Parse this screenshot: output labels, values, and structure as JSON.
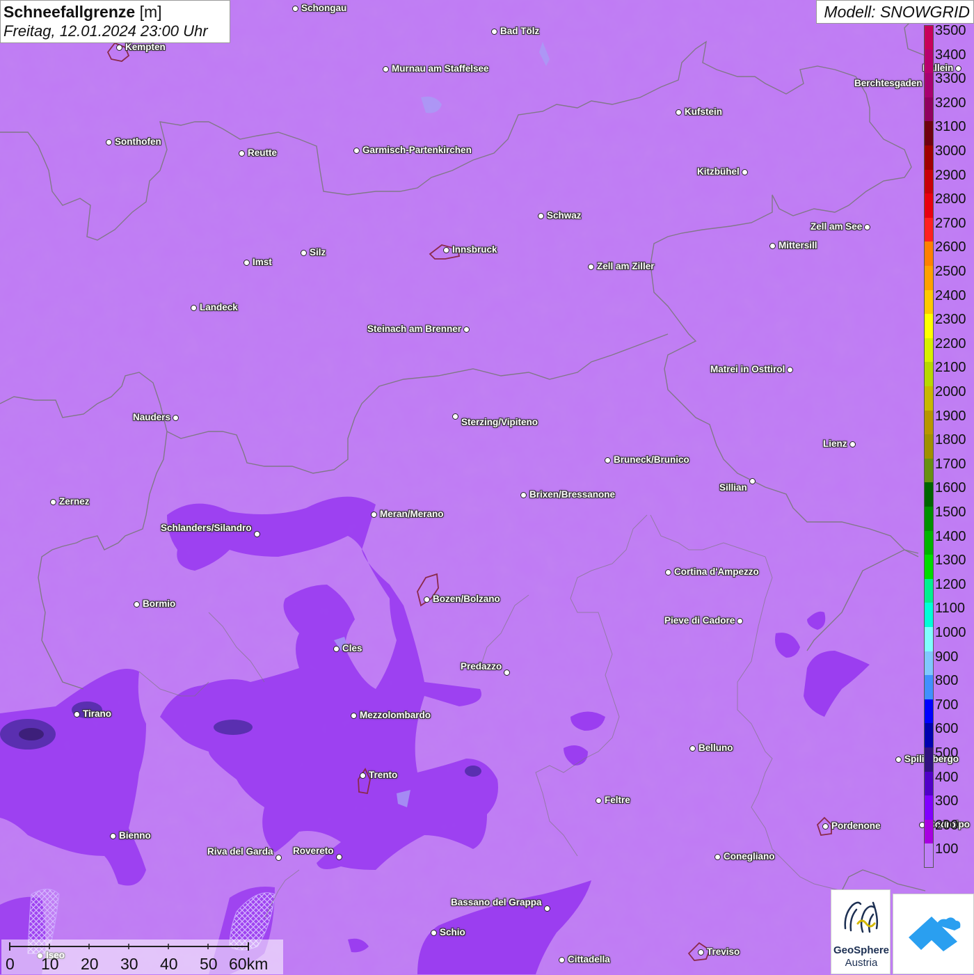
{
  "header": {
    "title": "Schneefallgrenze",
    "unit": "[m]",
    "datetime": "Freitag, 12.01.2024 23:00 Uhr",
    "model": "Modell: SNOWGRID"
  },
  "legend": {
    "labels": [
      "3500",
      "3400",
      "3300",
      "3200",
      "3100",
      "3000",
      "2900",
      "2800",
      "2700",
      "2600",
      "2500",
      "2400",
      "2300",
      "2200",
      "2100",
      "2000",
      "1900",
      "1800",
      "1700",
      "1600",
      "1500",
      "1400",
      "1300",
      "1200",
      "1100",
      "1000",
      "900",
      "800",
      "700",
      "600",
      "500",
      "400",
      "300",
      "200",
      "100"
    ],
    "colors": [
      "#c8005a",
      "#b8006e",
      "#a80070",
      "#900060",
      "#700010",
      "#a00000",
      "#c80008",
      "#e80010",
      "#ff2020",
      "#ff8000",
      "#ffa000",
      "#ffc800",
      "#ffff00",
      "#d8f000",
      "#b8d800",
      "#c8b800",
      "#b89600",
      "#a09000",
      "#689010",
      "#006400",
      "#009000",
      "#00b400",
      "#00dc00",
      "#00f090",
      "#00ffd8",
      "#80ffff",
      "#80c8ff",
      "#4090ff",
      "#0000ff",
      "#0000b0",
      "#301080",
      "#5000c8",
      "#8000ff",
      "#a800e0",
      "#c080f8"
    ]
  },
  "cities": [
    {
      "name": "Schongau"
    },
    {
      "name": "Bad Tölz"
    },
    {
      "name": "Kempten"
    },
    {
      "name": "Murnau am Staffelsee"
    },
    {
      "name": "Hallein"
    },
    {
      "name": "Berchtesgaden"
    },
    {
      "name": "Kufstein"
    },
    {
      "name": "Sonthofen"
    },
    {
      "name": "Reutte"
    },
    {
      "name": "Garmisch-Partenkirchen"
    },
    {
      "name": "Kitzbühel"
    },
    {
      "name": "Schwaz"
    },
    {
      "name": "Zell am See"
    },
    {
      "name": "Innsbruck"
    },
    {
      "name": "Mittersill"
    },
    {
      "name": "Imst"
    },
    {
      "name": "Silz"
    },
    {
      "name": "Zell am Ziller"
    },
    {
      "name": "Landeck"
    },
    {
      "name": "Steinach am Brenner"
    },
    {
      "name": "Matrei in Osttirol"
    },
    {
      "name": "Nauders"
    },
    {
      "name": "Sterzing/Vipiteno"
    },
    {
      "name": "Lienz"
    },
    {
      "name": "Bruneck/Brunico"
    },
    {
      "name": "Sillian"
    },
    {
      "name": "Zernez"
    },
    {
      "name": "Brixen/Bressanone"
    },
    {
      "name": "Meran/Merano"
    },
    {
      "name": "Schlanders/Silandro"
    },
    {
      "name": "Cortina d'Ampezzo"
    },
    {
      "name": "Bozen/Bolzano"
    },
    {
      "name": "Bormio"
    },
    {
      "name": "Pieve di Cadore"
    },
    {
      "name": "Cles"
    },
    {
      "name": "Predazzo"
    },
    {
      "name": "Tirano"
    },
    {
      "name": "Mezzolombardo"
    },
    {
      "name": "Belluno"
    },
    {
      "name": "Spilimbergo"
    },
    {
      "name": "Trento"
    },
    {
      "name": "Feltre"
    },
    {
      "name": "Pordenone"
    },
    {
      "name": "Codroipo"
    },
    {
      "name": "Bienno"
    },
    {
      "name": "Riva del Garda"
    },
    {
      "name": "Rovereto"
    },
    {
      "name": "Conegliano"
    },
    {
      "name": "Bassano del Grappa"
    },
    {
      "name": "Schio"
    },
    {
      "name": "Treviso"
    },
    {
      "name": "Cittadella"
    },
    {
      "name": "Iseo"
    }
  ],
  "scalebar": {
    "labels": [
      "0",
      "10",
      "20",
      "30",
      "40",
      "50",
      "60km"
    ]
  },
  "logos": {
    "geosphere_line1": "GeoSphere",
    "geosphere_line2": "Austria"
  }
}
